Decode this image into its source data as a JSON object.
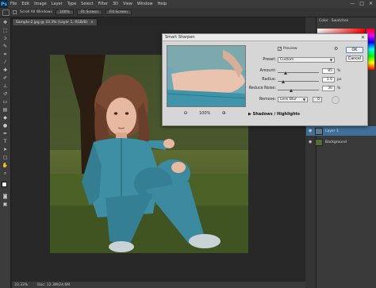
{
  "menu": {
    "logo": "Ps",
    "items": [
      "File",
      "Edit",
      "Image",
      "Layer",
      "Type",
      "Select",
      "Filter",
      "3D",
      "View",
      "Window",
      "Help"
    ],
    "win_min": "—",
    "win_max": "□",
    "win_close": "✕"
  },
  "options": {
    "scroll_all_label": "Scroll All Windows",
    "btn_100": "100%",
    "btn_fit": "Fit Screen",
    "btn_fill": "Fill Screen"
  },
  "document": {
    "tab_title": "Sample-2.jpg @ 33.3% (Layer 1, RGB/8)",
    "tab_close": "×",
    "status_zoom": "33.33%",
    "status_doc": "Doc: 12.3M/24.6M"
  },
  "panels": {
    "tab_color": "Color",
    "tab_swatches": "Swatches",
    "layers": [
      {
        "name": "Layer 1",
        "selected": true
      },
      {
        "name": "Background",
        "selected": false
      }
    ]
  },
  "dialog": {
    "title": "Smart Sharpen",
    "close": "✕",
    "preview_label": "Preview",
    "preview_checked": "✓",
    "preset_label": "Preset:",
    "preset_value": "Custom",
    "amount_label": "Amount:",
    "amount_value": "85",
    "amount_unit": "%",
    "radius_label": "Radius:",
    "radius_value": "1.0",
    "radius_unit": "px",
    "noise_label": "Reduce Noise:",
    "noise_value": "30",
    "noise_unit": "%",
    "remove_label": "Remove:",
    "remove_value": "Lens Blur",
    "angle_value": "0",
    "zoom_value": "100%",
    "zoom_out": "⊖",
    "zoom_in": "⊕",
    "shadows_label": "Shadows / Highlights",
    "ok_label": "OK",
    "cancel_label": "Cancel"
  },
  "colors": {
    "accent": "#3f6f9a",
    "dialog_bg": "#d6d6d6",
    "workspace": "#262626"
  }
}
